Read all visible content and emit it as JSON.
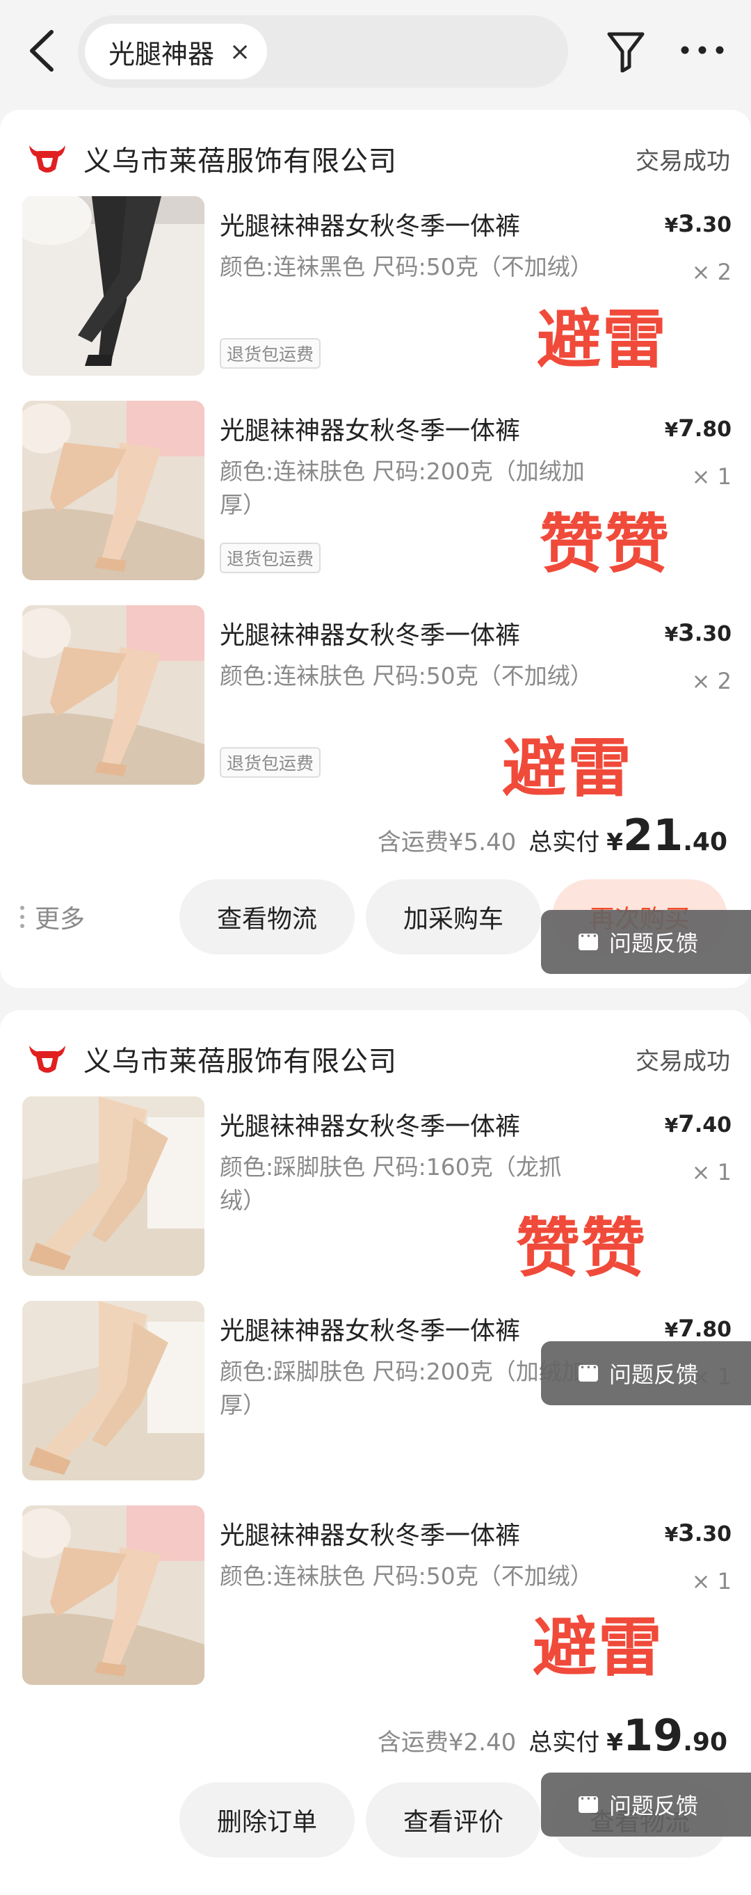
{
  "header": {
    "search_keyword": "光腿神器",
    "clear_glyph": "×",
    "icons": [
      "back-icon",
      "filter-icon",
      "more-icon"
    ]
  },
  "orders": [
    {
      "shop_name": "义乌市莱蓓服饰有限公司",
      "status": "交易成功",
      "items": [
        {
          "title": "光腿袜神器女秋冬季一体裤",
          "spec": "颜色:连袜黑色 尺码:50克（不加绒）",
          "tag": "退货包运费",
          "price_int": "3",
          "price_dec": ".30",
          "qty": "× 2",
          "stamp": "避雷"
        },
        {
          "title": "光腿袜神器女秋冬季一体裤",
          "spec": "颜色:连袜肤色 尺码:200克（加绒加厚）",
          "tag": "退货包运费",
          "price_int": "7",
          "price_dec": ".80",
          "qty": "× 1",
          "stamp": "赞赞"
        },
        {
          "title": "光腿袜神器女秋冬季一体裤",
          "spec": "颜色:连袜肤色 尺码:50克（不加绒）",
          "tag": "退货包运费",
          "price_int": "3",
          "price_dec": ".30",
          "qty": "× 2",
          "stamp": "避雷"
        }
      ],
      "shipping": "含运费¥5.40",
      "total_label": "总实付",
      "total_int": "21",
      "total_dec": ".40",
      "more_label": "更多",
      "buttons": [
        "查看物流",
        "加采购车",
        "再次购买"
      ]
    },
    {
      "shop_name": "义乌市莱蓓服饰有限公司",
      "status": "交易成功",
      "items": [
        {
          "title": "光腿袜神器女秋冬季一体裤",
          "spec": "颜色:踩脚肤色 尺码:160克（龙抓绒）",
          "tag": "",
          "price_int": "7",
          "price_dec": ".40",
          "qty": "× 1",
          "stamp": "赞赞"
        },
        {
          "title": "光腿袜神器女秋冬季一体裤",
          "spec": "颜色:踩脚肤色 尺码:200克（加绒加厚）",
          "tag": "",
          "price_int": "7",
          "price_dec": ".80",
          "qty": "× 1",
          "stamp": ""
        },
        {
          "title": "光腿袜神器女秋冬季一体裤",
          "spec": "颜色:连袜肤色 尺码:50克（不加绒）",
          "tag": "",
          "price_int": "3",
          "price_dec": ".30",
          "qty": "× 1",
          "stamp": "避雷"
        }
      ],
      "shipping": "含运费¥2.40",
      "total_label": "总实付",
      "total_int": "19",
      "total_dec": ".90",
      "buttons": [
        "删除订单",
        "查看评价",
        "查看物流"
      ]
    }
  ],
  "currency": "¥",
  "feedback_label": "问题反馈",
  "colors": {
    "accent": "#f04a3a",
    "brand_red": "#e02020",
    "overlay": "#646464"
  }
}
